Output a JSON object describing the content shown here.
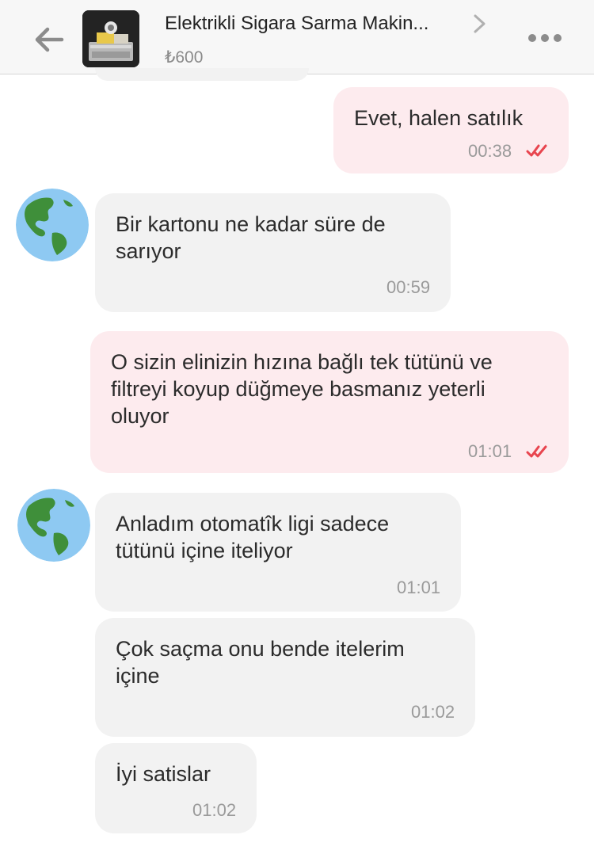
{
  "header": {
    "product_title": "Elektrikli Sigara Sarma Makin...",
    "price": "₺600"
  },
  "messages": [
    {
      "side": "out",
      "text": "Evet, halen satılık",
      "time": "00:38",
      "status": "read"
    },
    {
      "side": "in",
      "text": "Bir kartonu ne kadar süre de sarıyor",
      "time": "00:59"
    },
    {
      "side": "out",
      "text": "O sizin elinizin hızına bağlı tek tütünü ve filtreyi koyup düğmeye basmanız yeterli oluyor",
      "time": "01:01",
      "status": "read"
    },
    {
      "side": "in",
      "text": "Anladım otomatîk ligi sadece tütünü içine iteliyor",
      "time": "01:01"
    },
    {
      "side": "in",
      "text": "Çok saçma onu bende itelerim içine",
      "time": "01:02"
    },
    {
      "side": "in",
      "text": "İyi satislar",
      "time": "01:02"
    }
  ],
  "colors": {
    "incoming_bubble": "#f2f2f2",
    "outgoing_bubble": "#fdebee",
    "read_tick": "#e8454f",
    "header_bg": "#f7f7f7"
  },
  "icons": {
    "back": "arrow-left-icon",
    "forward": "chevron-right-icon",
    "menu": "more-dots-icon",
    "avatar": "globe-avatar-icon",
    "read_status": "double-check-icon"
  }
}
